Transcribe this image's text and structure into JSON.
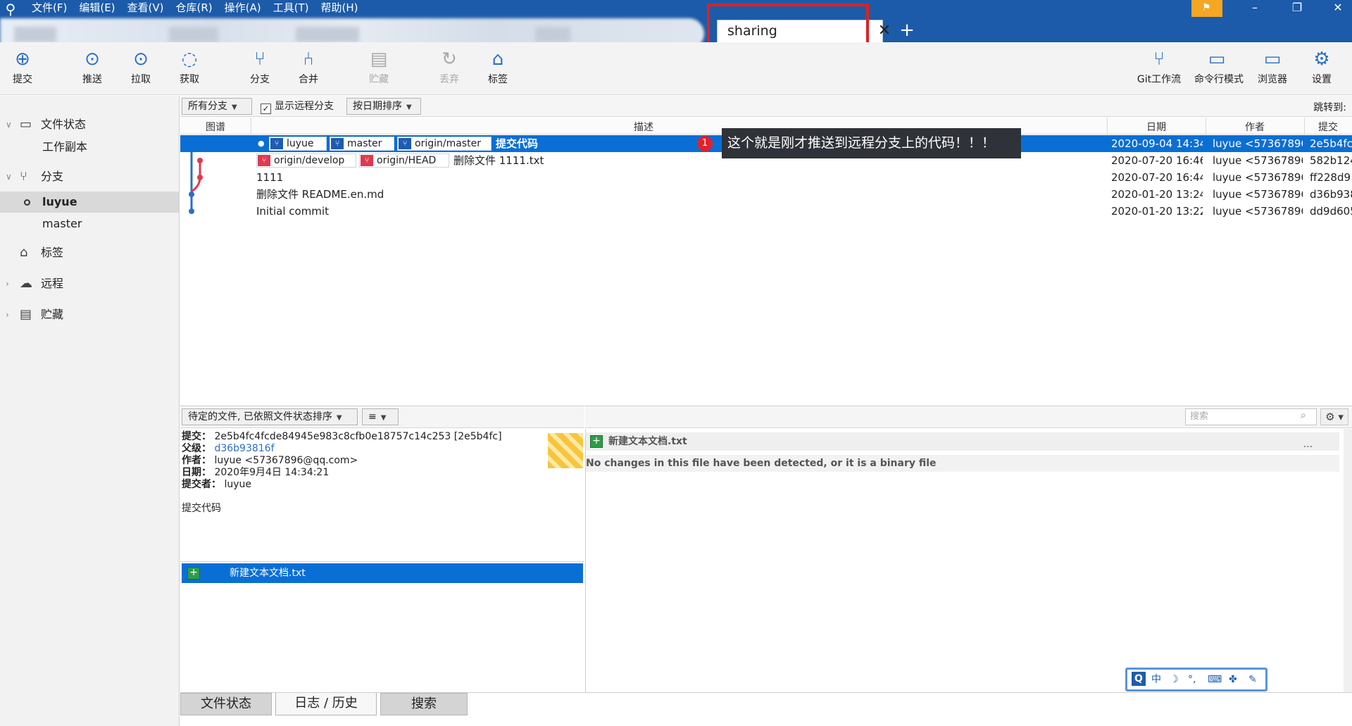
{
  "menu": [
    "文件(F)",
    "编辑(E)",
    "查看(V)",
    "仓库(R)",
    "操作(A)",
    "工具(T)",
    "帮助(H)"
  ],
  "tab": {
    "label": "sharing",
    "close": "✕",
    "add": "+"
  },
  "window_controls": {
    "minimize": "–",
    "restore": "❐",
    "close": "✕"
  },
  "toolbar": {
    "commit": "提交",
    "push": "推送",
    "pull": "拉取",
    "fetch": "获取",
    "branch": "分支",
    "merge": "合并",
    "stash": "贮藏",
    "discard": "丢弃",
    "tag": "标签",
    "git_flow": "Git工作流",
    "terminal": "命令行模式",
    "explorer": "浏览器",
    "settings": "设置"
  },
  "sidebar": {
    "file_status": "文件状态",
    "working_copy": "工作副本",
    "branches": "分支",
    "branch_items": [
      "luyue",
      "master"
    ],
    "tags": "标签",
    "remotes": "远程",
    "stashes": "贮藏"
  },
  "filter": {
    "all_branches": "所有分支",
    "show_remote": "显示远程分支",
    "sort": "按日期排序",
    "jump_to": "跳转到:"
  },
  "columns": {
    "graph": "图谱",
    "description": "描述",
    "date": "日期",
    "author": "作者",
    "commit": "提交"
  },
  "commits": [
    {
      "refs": [
        "luyue",
        "master",
        "origin/master"
      ],
      "message": "提交代码",
      "date": "2020-09-04 14:34",
      "author": "luyue <57367896",
      "hash": "2e5b4fc"
    },
    {
      "refs": [
        "origin/develop",
        "origin/HEAD"
      ],
      "message": "删除文件 1111.txt",
      "date": "2020-07-20 16:46",
      "author": "luyue <57367896",
      "hash": "582b124"
    },
    {
      "refs": [],
      "message": "1111",
      "date": "2020-07-20 16:44",
      "author": "luyue <57367896",
      "hash": "ff228d9"
    },
    {
      "refs": [],
      "message": "删除文件 README.en.md",
      "date": "2020-01-20 13:24",
      "author": "luyue <57367896",
      "hash": "d36b938"
    },
    {
      "refs": [],
      "message": "Initial commit",
      "date": "2020-01-20 13:22",
      "author": "luyue <57367896",
      "hash": "dd9d605"
    }
  ],
  "annotation": {
    "badge": "1",
    "text": "这个就是刚才推送到远程分支上的代码！！！"
  },
  "pending_files_dropdown": "待定的文件, 已依照文件状态排序",
  "commit_detail": {
    "commit_label": "提交：",
    "commit_value": "2e5b4fc4fcde84945e983c8cfb0e18757c14c253 [2e5b4fc]",
    "parent_label": "父级：",
    "parent_value": "d36b93816f",
    "author_label": "作者：",
    "author_value": "luyue <57367896@qq.com>",
    "date_label": "日期：",
    "date_value": "2020年9月4日 14:34:21",
    "committer_label": "提交者：",
    "committer_value": "luyue",
    "message": "提交代码"
  },
  "files": [
    "新建文本文档.txt"
  ],
  "diff": {
    "file": "新建文本文档.txt",
    "message": "No changes in this file have been detected, or it is a binary file",
    "more": "···"
  },
  "search_placeholder": "搜索",
  "ime": [
    "中",
    "☽",
    "°,",
    "⌨",
    "✤",
    "✎"
  ],
  "bottom_tabs": [
    "文件状态",
    "日志 / 历史",
    "搜索"
  ],
  "colors": {
    "accent": "#0a6fd5",
    "titlebar": "#1c5ba9",
    "highlight": "#e02020",
    "remote_ref": "#e0394f",
    "local_ref": "#1e5cb0"
  }
}
